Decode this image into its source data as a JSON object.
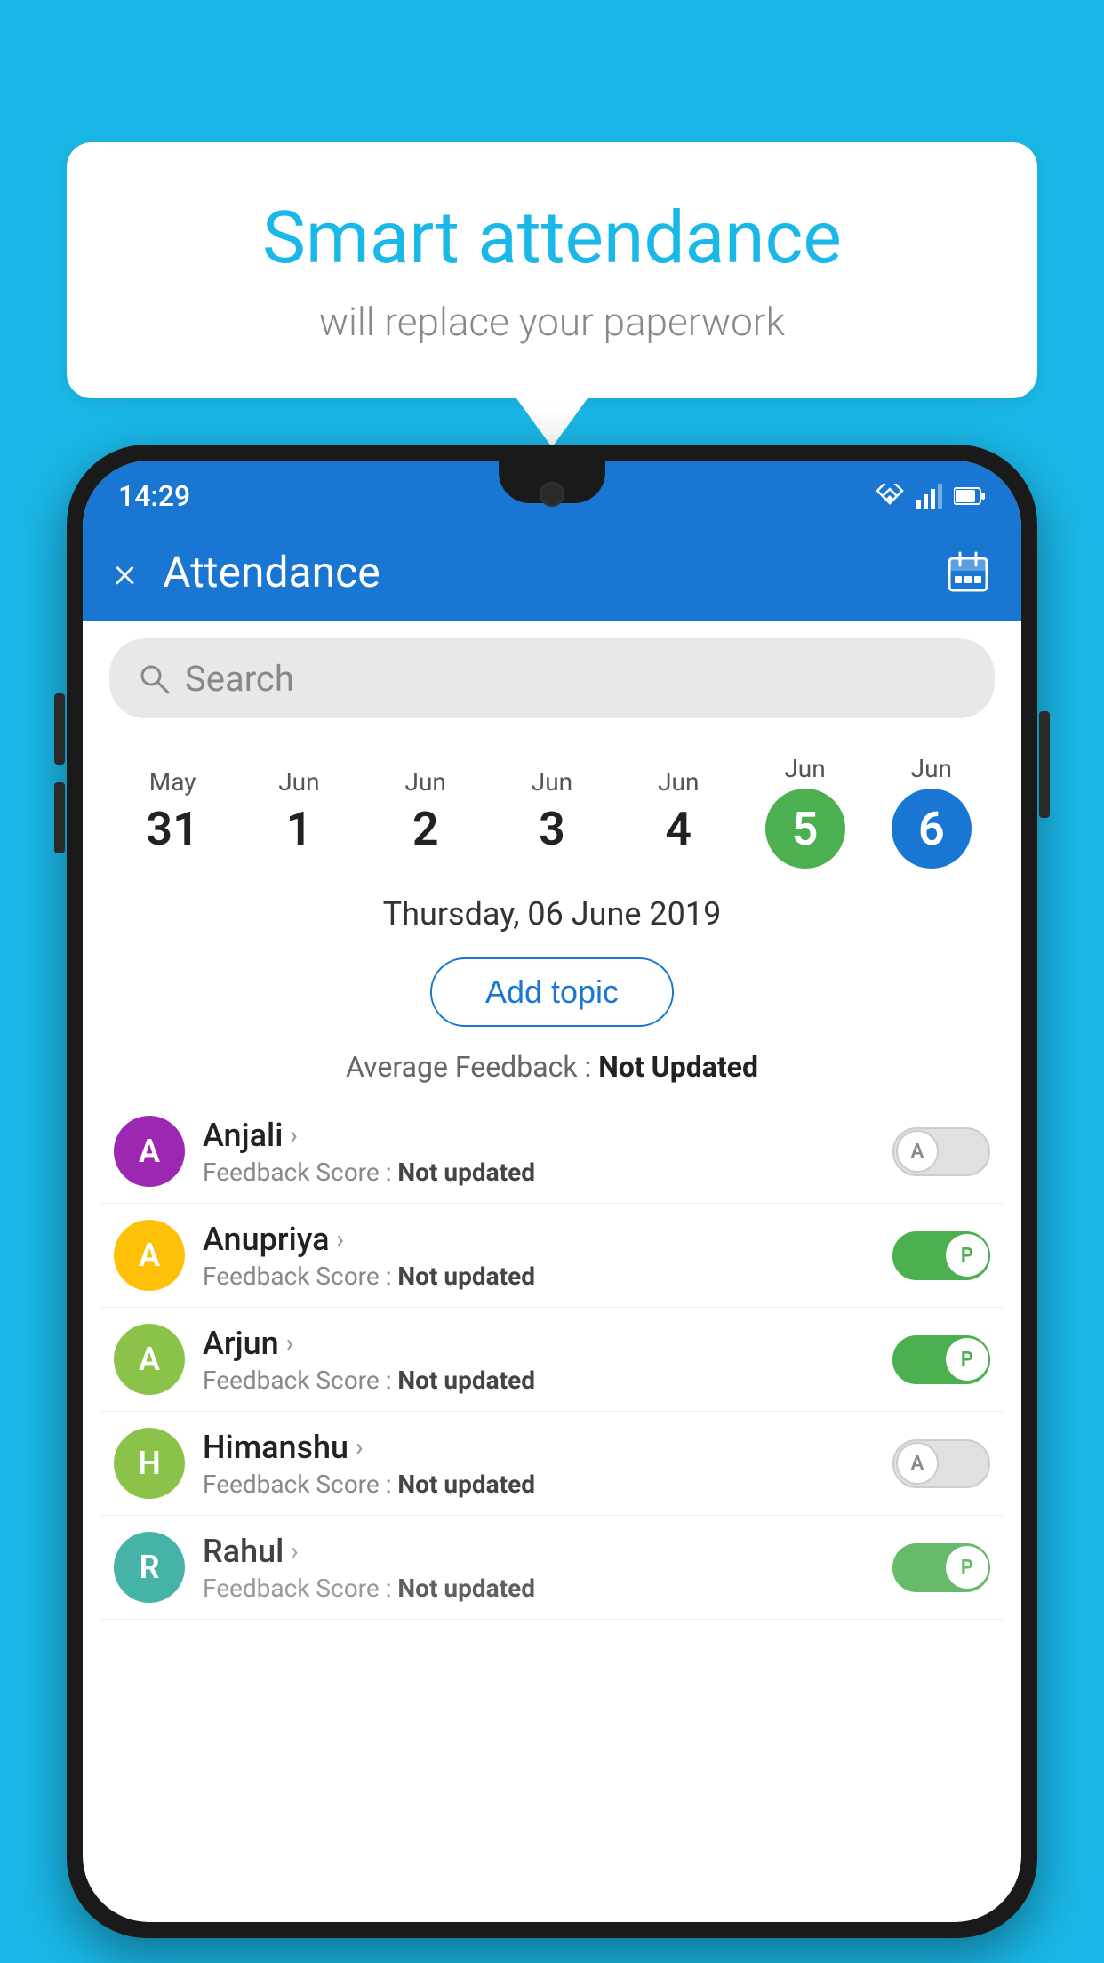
{
  "background_color": "#1ab8e8",
  "hero": {
    "title": "Smart attendance",
    "subtitle": "will replace your paperwork"
  },
  "status_bar": {
    "time": "14:29",
    "icons": [
      "wifi",
      "signal",
      "battery"
    ]
  },
  "app_bar": {
    "title": "Attendance",
    "close_label": "×",
    "calendar_icon": "📅"
  },
  "search": {
    "placeholder": "Search"
  },
  "date_strip": {
    "dates": [
      {
        "month": "May",
        "day": "31",
        "highlight": null
      },
      {
        "month": "Jun",
        "day": "1",
        "highlight": null
      },
      {
        "month": "Jun",
        "day": "2",
        "highlight": null
      },
      {
        "month": "Jun",
        "day": "3",
        "highlight": null
      },
      {
        "month": "Jun",
        "day": "4",
        "highlight": null
      },
      {
        "month": "Jun",
        "day": "5",
        "highlight": "green"
      },
      {
        "month": "Jun",
        "day": "6",
        "highlight": "blue"
      }
    ]
  },
  "selected_date": "Thursday, 06 June 2019",
  "add_topic_label": "Add topic",
  "avg_feedback_label": "Average Feedback :",
  "avg_feedback_value": "Not Updated",
  "students": [
    {
      "name": "Anjali",
      "avatar_letter": "A",
      "avatar_color": "purple",
      "feedback_label": "Feedback Score :",
      "feedback_value": "Not updated",
      "toggle": "off",
      "toggle_letter": "A"
    },
    {
      "name": "Anupriya",
      "avatar_letter": "A",
      "avatar_color": "yellow",
      "feedback_label": "Feedback Score :",
      "feedback_value": "Not updated",
      "toggle": "on",
      "toggle_letter": "P"
    },
    {
      "name": "Arjun",
      "avatar_letter": "A",
      "avatar_color": "lightgreen",
      "feedback_label": "Feedback Score :",
      "feedback_value": "Not updated",
      "toggle": "on",
      "toggle_letter": "P"
    },
    {
      "name": "Himanshu",
      "avatar_letter": "H",
      "avatar_color": "green2",
      "feedback_label": "Feedback Score :",
      "feedback_value": "Not updated",
      "toggle": "off",
      "toggle_letter": "A"
    },
    {
      "name": "Rahul",
      "avatar_letter": "R",
      "avatar_color": "teal",
      "feedback_label": "Feedback Score :",
      "feedback_value": "Not updated",
      "toggle": "on",
      "toggle_letter": "P"
    }
  ]
}
